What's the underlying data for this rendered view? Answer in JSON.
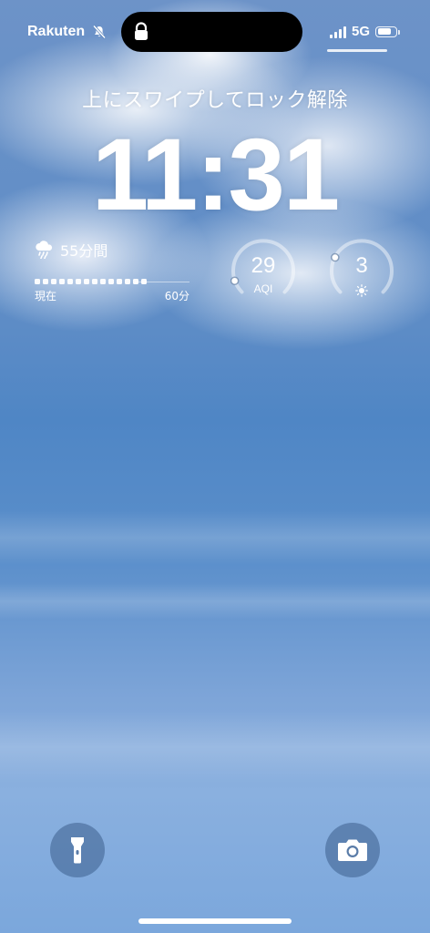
{
  "status_bar": {
    "carrier": "Rakuten",
    "silent_icon": "bell-slash-icon",
    "lock_icon": "lock-icon",
    "signal_bars": 4,
    "network": "5G",
    "battery_icon": "battery-icon",
    "battery_level": 0.6
  },
  "lock_screen": {
    "unlock_hint": "上にスワイプしてロック解除",
    "time": "11:31"
  },
  "widgets": {
    "rain": {
      "icon": "cloud-rain-icon",
      "label": "55分間",
      "axis_start": "現在",
      "axis_end": "60分",
      "intensity_steps": 14
    },
    "aqi": {
      "value": "29",
      "label": "AQI",
      "level": 0.1
    },
    "uv": {
      "value": "3",
      "icon": "sun-icon",
      "level": 0.27
    }
  },
  "quick_actions": {
    "flashlight_icon": "flashlight-icon",
    "camera_icon": "camera-icon"
  },
  "colors": {
    "sky_top": "#6d93c8",
    "sky_bottom": "#7ba7dc",
    "button_bg": "#3c5f8c"
  }
}
